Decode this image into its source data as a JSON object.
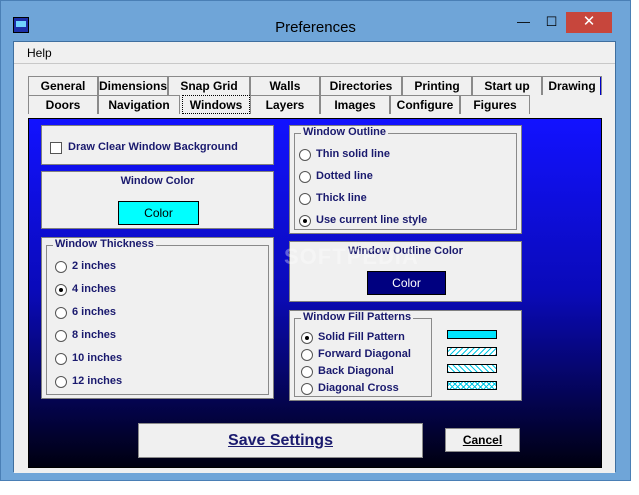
{
  "window": {
    "title": "Preferences"
  },
  "menu": {
    "help": "Help"
  },
  "tabs_row1": [
    "General",
    "Dimensions",
    "Snap Grid",
    "Walls",
    "Directories",
    "Printing",
    "Start up",
    "Drawing"
  ],
  "tabs_row2": [
    "Doors",
    "Navigation",
    "Windows",
    "Layers",
    "Images",
    "Configure",
    "Figures"
  ],
  "active_tab": "Windows",
  "clear_bg": {
    "label": "Draw Clear Window Background",
    "checked": false
  },
  "window_color": {
    "title": "Window Color",
    "button": "Color",
    "color": "#00ffff"
  },
  "thickness": {
    "title": "Window Thickness",
    "options": [
      "2 inches",
      "4 inches",
      "6 inches",
      "8 inches",
      "10 inches",
      "12 inches"
    ],
    "selected": "4 inches"
  },
  "outline": {
    "title": "Window Outline",
    "options": [
      "Thin solid line",
      "Dotted line",
      "Thick line",
      "Use current line style"
    ],
    "selected": "Use current line style"
  },
  "outline_color": {
    "title": "Window Outline Color",
    "button": "Color",
    "color": "#000080"
  },
  "fill": {
    "title": "Window Fill Patterns",
    "options": [
      "Solid Fill Pattern",
      "Forward Diagonal",
      "Back Diagonal",
      "Diagonal Cross"
    ],
    "selected": "Solid Fill Pattern"
  },
  "buttons": {
    "save": "Save Settings",
    "cancel": "Cancel"
  },
  "watermark": "SOFTPEDIA",
  "icons": {
    "app": "app-icon",
    "minimize": "minimize-icon",
    "maximize": "maximize-icon",
    "close": "close-icon"
  }
}
